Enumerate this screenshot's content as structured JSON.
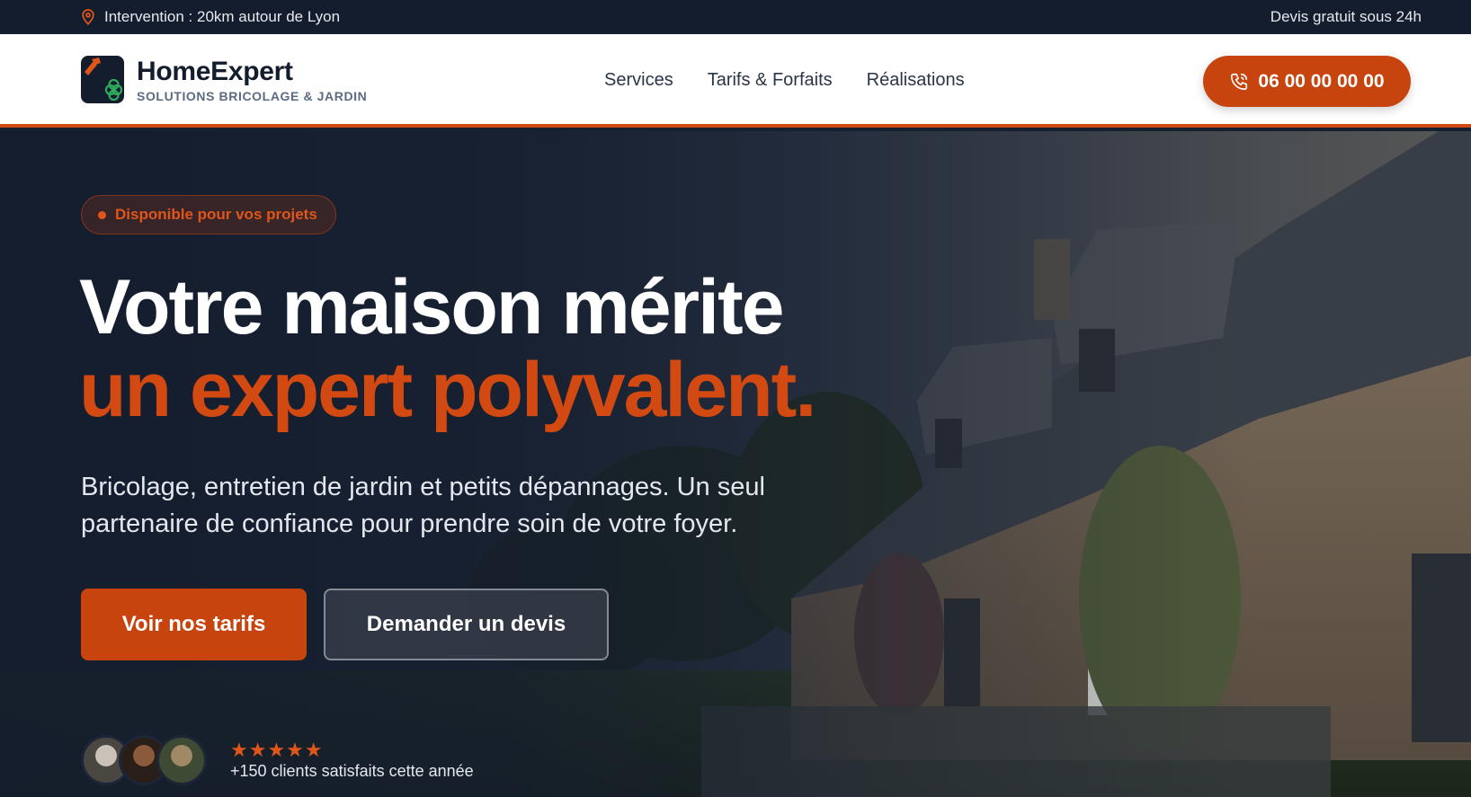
{
  "topbar": {
    "location_icon": "map-pin-icon",
    "location_text": "Intervention : 20km autour de Lyon",
    "quote_text": "Devis gratuit sous 24h"
  },
  "header": {
    "brand_name": "HomeExpert",
    "brand_tagline": "SOLUTIONS BRICOLAGE & JARDIN",
    "nav": [
      {
        "label": "Services"
      },
      {
        "label": "Tarifs & Forfaits"
      },
      {
        "label": "Réalisations"
      }
    ],
    "phone_label": "06 00 00 00 00",
    "phone_icon": "phone-icon"
  },
  "hero": {
    "badge": "Disponible pour vos projets",
    "title_line1": "Votre maison mérite",
    "title_line2": "un expert polyvalent.",
    "subtitle": "Bricolage, entretien de jardin et petits dépannages. Un seul partenaire de confiance pour prendre soin de votre foyer.",
    "cta_primary": "Voir nos tarifs",
    "cta_secondary": "Demander un devis",
    "stars": "★★★★★",
    "rating_value": 5,
    "social_proof": "+150 clients satisfaits cette année"
  },
  "colors": {
    "accent": "#c8440e",
    "dark": "#141d2d",
    "white": "#ffffff"
  }
}
